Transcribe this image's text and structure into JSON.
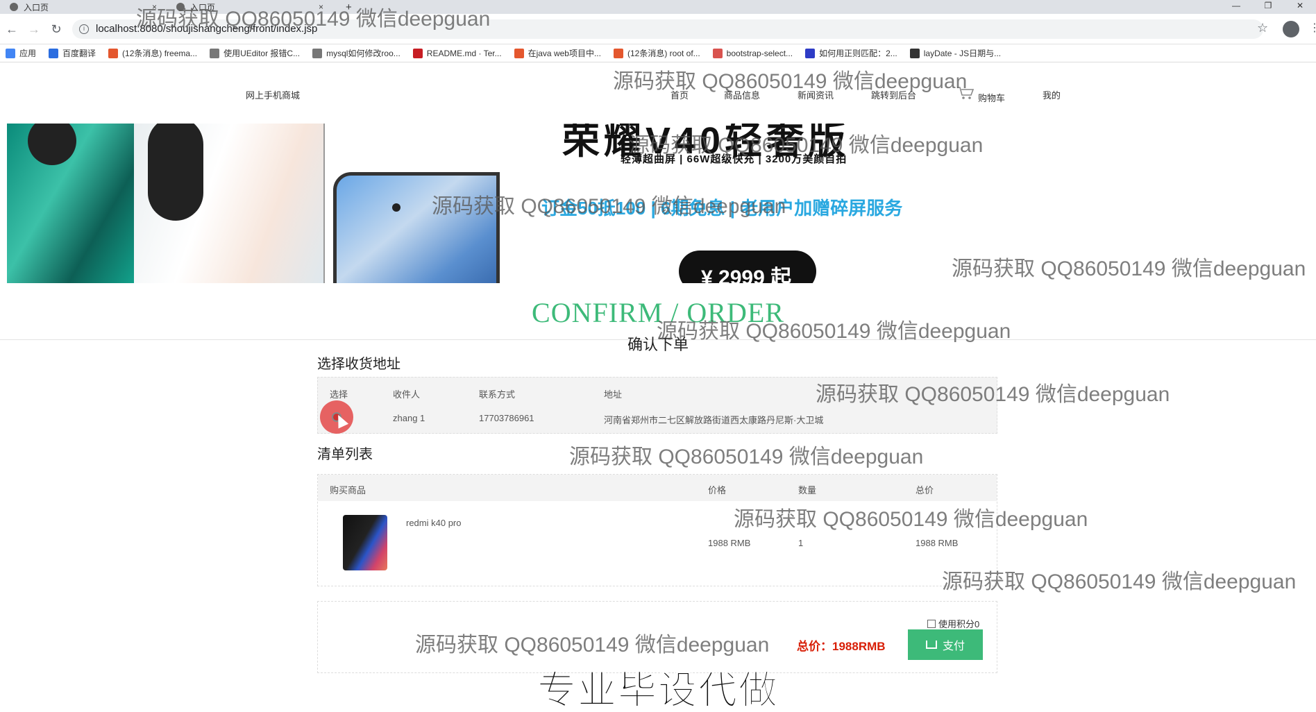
{
  "browser": {
    "tabs": [
      {
        "title": "入口页"
      },
      {
        "title": "入口页"
      }
    ],
    "new_tab_symbol": "+",
    "url": "localhost:8080/shoujishangcheng/front/index.jsp",
    "window_controls": [
      "—",
      "❐",
      "✕"
    ],
    "bookmarks": [
      {
        "label": "应用",
        "color": "#4285f4"
      },
      {
        "label": "百度翻译",
        "color": "#2b6de0"
      },
      {
        "label": "(12条消息) freema...",
        "color": "#e4572e"
      },
      {
        "label": "使用UEditor 报错C...",
        "color": "#777777"
      },
      {
        "label": "mysql如何修改roo...",
        "color": "#777777"
      },
      {
        "label": "README.md · Ter...",
        "color": "#c71d23"
      },
      {
        "label": "在java web项目中...",
        "color": "#e4572e"
      },
      {
        "label": "(12条消息) root of...",
        "color": "#e4572e"
      },
      {
        "label": "bootstrap-select...",
        "color": "#d9534f"
      },
      {
        "label": "如何用正则匹配：2...",
        "color": "#2e3cc6"
      },
      {
        "label": "layDate - JS日期与...",
        "color": "#333333"
      }
    ]
  },
  "site": {
    "brand": "网上手机商城",
    "nav": [
      "首页",
      "商品信息",
      "新闻资讯",
      "跳转到后台",
      "购物车",
      "我的"
    ]
  },
  "banner": {
    "headline": "荣耀V40轻奢版",
    "subline": "轻薄超曲屏 | 66W超级快充 | 3200万美颜自拍",
    "promo": "订金50抵100 | 6期免息 | 老用户加赠碎屏服务",
    "price": "¥ 2999 起"
  },
  "page": {
    "title_en": "CONFIRM / ORDER",
    "title_cn": "确认下单"
  },
  "address_section": {
    "title": "选择收货地址",
    "headers": [
      "选择",
      "收件人",
      "联系方式",
      "地址"
    ],
    "rows": [
      {
        "recipient": "zhang 1",
        "phone": "17703786961",
        "address": "河南省郑州市二七区解放路街道西太康路丹尼斯·大卫城"
      }
    ]
  },
  "list_section": {
    "title": "清单列表",
    "headers": [
      "购买商品",
      "价格",
      "数量",
      "总价"
    ],
    "items": [
      {
        "name": "redmi k40 pro",
        "price": "1988 RMB",
        "qty": "1",
        "total": "1988 RMB"
      }
    ]
  },
  "pay": {
    "use_points": "使用积分0",
    "total_label": "总价：1988RMB",
    "button": "支付"
  },
  "overlay": {
    "bottom_banner": "专业毕设代做",
    "watermark": "源码获取 QQ86050149 微信deepguan"
  },
  "colors": {
    "accent_green": "#3dba79",
    "price_red": "#d81e06"
  }
}
